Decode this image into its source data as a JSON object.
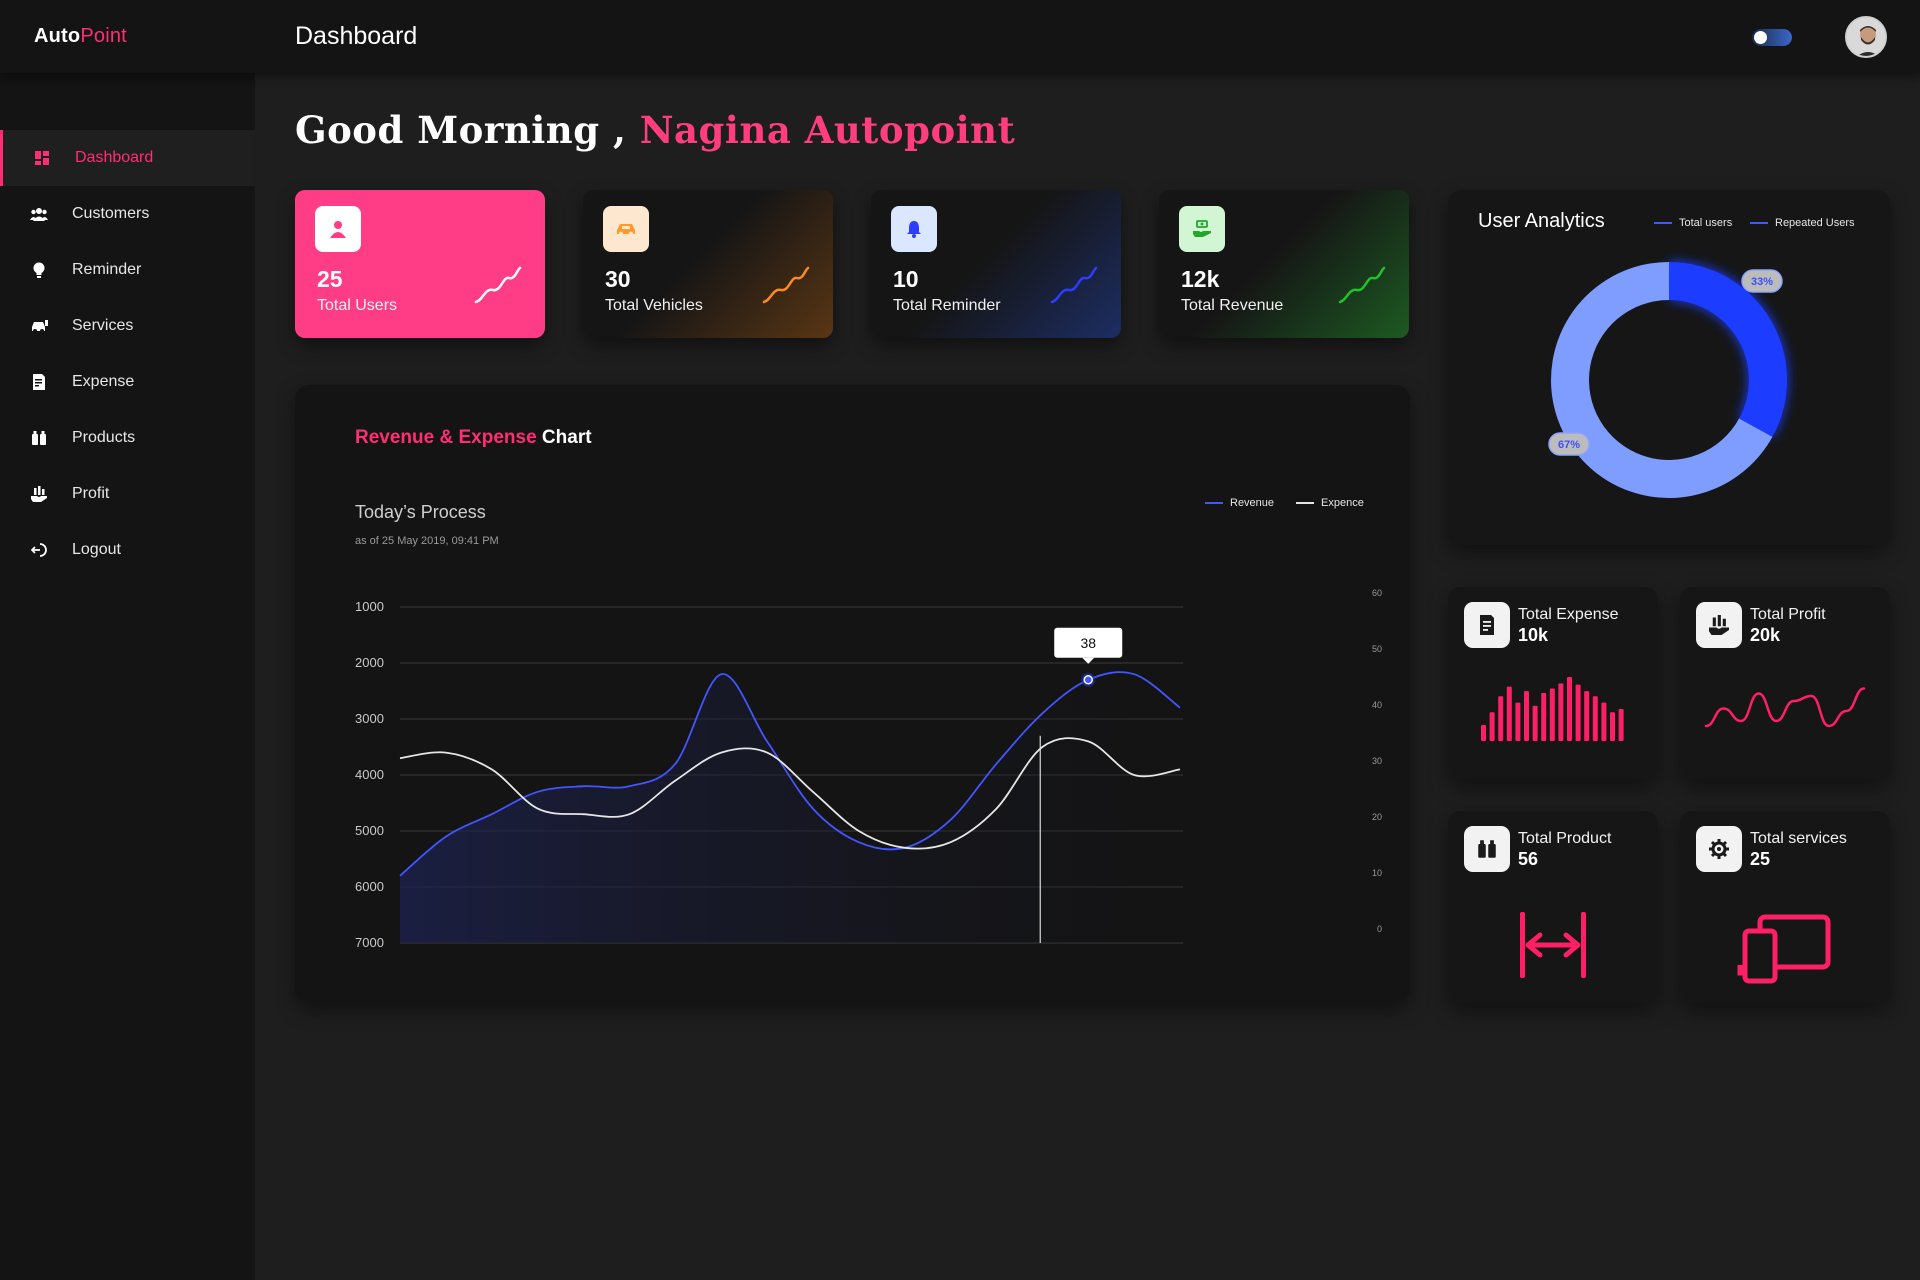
{
  "header": {
    "brand_part1": "Auto",
    "brand_part2": "Point",
    "page_title": "Dashboard",
    "theme_toggle_icon": "moon-toggle-icon",
    "avatar_icon": "user-avatar"
  },
  "sidebar": {
    "items": [
      {
        "label": "Dashboard",
        "icon": "dashboard-icon",
        "active": true
      },
      {
        "label": "Customers",
        "icon": "customers-icon",
        "active": false
      },
      {
        "label": "Reminder",
        "icon": "bulb-icon",
        "active": false
      },
      {
        "label": "Services",
        "icon": "car-service-icon",
        "active": false
      },
      {
        "label": "Expense",
        "icon": "receipt-icon",
        "active": false
      },
      {
        "label": "Products",
        "icon": "products-icon",
        "active": false
      },
      {
        "label": "Profit",
        "icon": "profit-icon",
        "active": false
      },
      {
        "label": "Logout",
        "icon": "logout-icon",
        "active": false
      }
    ]
  },
  "greeting": {
    "prefix": "Good Morning ,",
    "name": "Nagina Autopoint"
  },
  "stats": [
    {
      "value": "25",
      "label": "Total Users",
      "icon": "user-icon",
      "accent": "#ff3d87"
    },
    {
      "value": "30",
      "label": "Total Vehicles",
      "icon": "car-icon",
      "accent": "#ff8a1f"
    },
    {
      "value": "10",
      "label": "Total Reminder",
      "icon": "bell-icon",
      "accent": "#2d3cff"
    },
    {
      "value": "12k",
      "label": "Total Revenue",
      "icon": "money-icon",
      "accent": "#1fc22a"
    }
  ],
  "revenue_chart": {
    "title_part1": "Revenue & Expense",
    "title_part2": "Chart",
    "subtitle": "Today’s Process",
    "date": "as of 25 May 2019, 09:41 PM",
    "tooltip": "38"
  },
  "chart_data": [
    {
      "type": "line",
      "left_axis_ticks": [
        "1000",
        "2000",
        "3000",
        "4000",
        "5000",
        "6000",
        "7000"
      ],
      "right_axis_ticks": [
        "60",
        "50",
        "40",
        "30",
        "20",
        "10",
        "0"
      ],
      "ylim": [
        0,
        60
      ],
      "grid": true,
      "legend_position": "top-right",
      "x": [
        0,
        2,
        4,
        6,
        8,
        10,
        12,
        14,
        16,
        18,
        20,
        22,
        24,
        26,
        28,
        30,
        32,
        34
      ],
      "series": [
        {
          "name": "Revenue",
          "color": "#4255ff",
          "area": true,
          "values": [
            12,
            19,
            23,
            27,
            28,
            28,
            32,
            48,
            36,
            24,
            18,
            17,
            22,
            32,
            41,
            47,
            48,
            42
          ]
        },
        {
          "name": "Expence",
          "color": "#e6e6e6",
          "area": false,
          "values": [
            33,
            34,
            31,
            24,
            23,
            23,
            29,
            34,
            34,
            27,
            20,
            17,
            18,
            24,
            35,
            36,
            30,
            31
          ]
        }
      ],
      "highlight": {
        "x": 30,
        "value": 38
      }
    },
    {
      "type": "pie",
      "title": "User Analytics",
      "categories": [
        "Total users",
        "Repeated Users"
      ],
      "values": [
        67,
        33
      ],
      "labels": [
        "67%",
        "33%"
      ],
      "colors": [
        "#7f9cff",
        "#1d3cff"
      ]
    }
  ],
  "kpis": [
    {
      "label": "Total Expense",
      "value": "10k",
      "icon": "receipt-icon",
      "viz": "bars",
      "bars": [
        0.25,
        0.45,
        0.7,
        0.85,
        0.6,
        0.78,
        0.55,
        0.75,
        0.82,
        0.9,
        1.0,
        0.88,
        0.78,
        0.7,
        0.6,
        0.45,
        0.5
      ]
    },
    {
      "label": "Total Profit",
      "value": "20k",
      "icon": "profit-icon",
      "viz": "line",
      "points": [
        0.1,
        0.45,
        0.2,
        0.75,
        0.2,
        0.6,
        0.7,
        0.1,
        0.4,
        0.85
      ]
    },
    {
      "label": "Total Product",
      "value": "56",
      "icon": "products-icon",
      "viz": "width-icon"
    },
    {
      "label": "Total services",
      "value": "25",
      "icon": "gear-icon",
      "viz": "devices-icon"
    }
  ],
  "colors": {
    "accent": "#ff2e72",
    "panel": "#141414",
    "background": "#1e1e1e"
  }
}
